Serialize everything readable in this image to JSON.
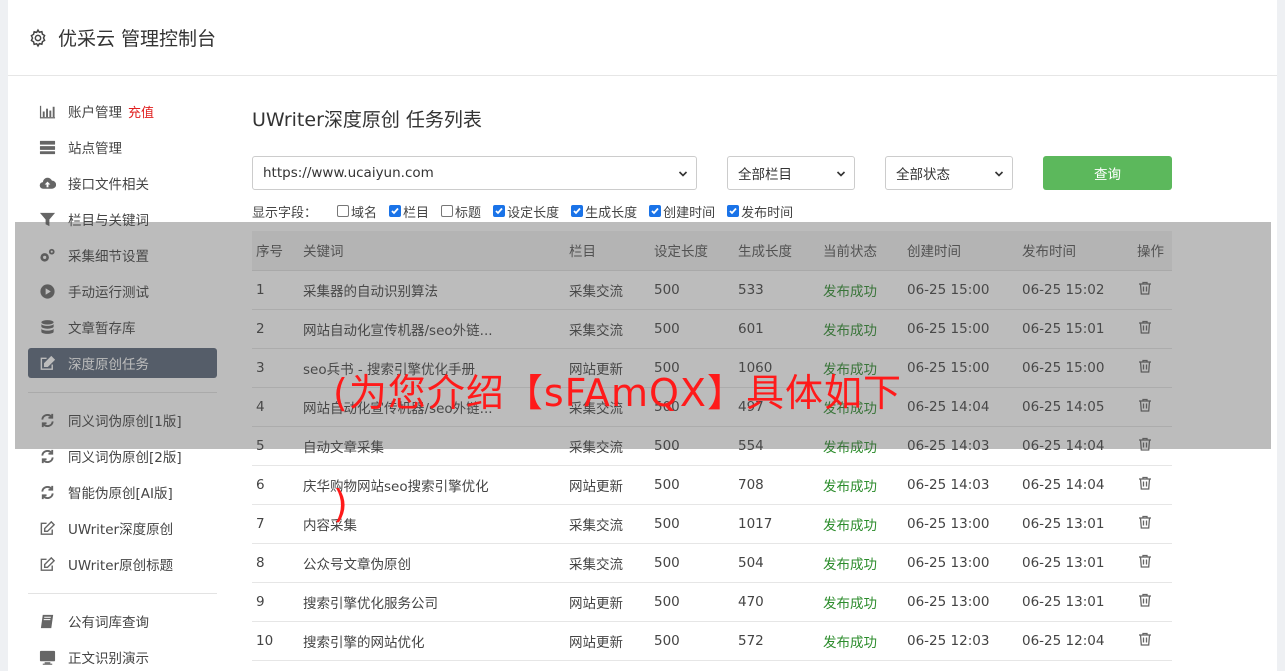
{
  "header": {
    "title": "优采云 管理控制台"
  },
  "sidebar": {
    "groups": [
      [
        {
          "label": "账户管理",
          "badge": "充值",
          "icon": "bar-chart-icon"
        },
        {
          "label": "站点管理",
          "icon": "server-icon"
        },
        {
          "label": "接口文件相关",
          "icon": "cloud-upload-icon"
        },
        {
          "label": "栏目与关键词",
          "icon": "filter-icon"
        },
        {
          "label": "采集细节设置",
          "icon": "cogs-icon"
        },
        {
          "label": "手动运行测试",
          "icon": "play-circle-icon"
        },
        {
          "label": "文章暂存库",
          "icon": "database-icon"
        },
        {
          "label": "深度原创任务",
          "icon": "edit-icon",
          "active": true
        }
      ],
      [
        {
          "label": "同义词伪原创[1版]",
          "icon": "refresh-icon"
        },
        {
          "label": "同义词伪原创[2版]",
          "icon": "refresh-icon"
        },
        {
          "label": "智能伪原创[AI版]",
          "icon": "refresh-icon"
        },
        {
          "label": "UWriter深度原创",
          "icon": "edit-icon"
        },
        {
          "label": "UWriter原创标题",
          "icon": "edit-icon"
        }
      ],
      [
        {
          "label": "公有词库查询",
          "icon": "book-icon"
        },
        {
          "label": "正文识别演示",
          "icon": "monitor-icon"
        }
      ]
    ]
  },
  "main": {
    "title": "UWriter深度原创 任务列表",
    "filters": {
      "site": "https://www.ucaiyun.com",
      "column": "全部栏目",
      "status": "全部状态",
      "query_label": "查询"
    },
    "fields_label": "显示字段：",
    "fields": [
      {
        "label": "域名",
        "checked": false
      },
      {
        "label": "栏目",
        "checked": true
      },
      {
        "label": "标题",
        "checked": false
      },
      {
        "label": "设定长度",
        "checked": true
      },
      {
        "label": "生成长度",
        "checked": true
      },
      {
        "label": "创建时间",
        "checked": true
      },
      {
        "label": "发布时间",
        "checked": true
      }
    ],
    "table": {
      "headers": [
        "序号",
        "关键词",
        "栏目",
        "设定长度",
        "生成长度",
        "当前状态",
        "创建时间",
        "发布时间",
        "操作"
      ],
      "rows": [
        [
          "1",
          "采集器的自动识别算法",
          "采集交流",
          "500",
          "533",
          "发布成功",
          "06-25 15:00",
          "06-25 15:02"
        ],
        [
          "2",
          "网站自动化宣传机器/seo外链...",
          "采集交流",
          "500",
          "601",
          "发布成功",
          "06-25 15:00",
          "06-25 15:01"
        ],
        [
          "3",
          "seo兵书 - 搜索引擎优化手册",
          "网站更新",
          "500",
          "1060",
          "发布成功",
          "06-25 15:00",
          "06-25 15:00"
        ],
        [
          "4",
          "网站自动化宣传机器/seo外链...",
          "采集交流",
          "500",
          "497",
          "发布成功",
          "06-25 14:04",
          "06-25 14:05"
        ],
        [
          "5",
          "自动文章采集",
          "采集交流",
          "500",
          "554",
          "发布成功",
          "06-25 14:03",
          "06-25 14:04"
        ],
        [
          "6",
          "庆华购物网站seo搜索引擎优化",
          "网站更新",
          "500",
          "708",
          "发布成功",
          "06-25 14:03",
          "06-25 14:04"
        ],
        [
          "7",
          "内容采集",
          "采集交流",
          "500",
          "1017",
          "发布成功",
          "06-25 13:00",
          "06-25 13:01"
        ],
        [
          "8",
          "公众号文章伪原创",
          "采集交流",
          "500",
          "504",
          "发布成功",
          "06-25 13:00",
          "06-25 13:01"
        ],
        [
          "9",
          "搜索引擎优化服务公司",
          "网站更新",
          "500",
          "470",
          "发布成功",
          "06-25 13:00",
          "06-25 13:01"
        ],
        [
          "10",
          "搜索引擎的网站优化",
          "网站更新",
          "500",
          "572",
          "发布成功",
          "06-25 12:03",
          "06-25 12:04"
        ]
      ]
    }
  },
  "overlay": {
    "text_line1": "(为您介绍【sFAmQX】具体如下",
    "text_line2": ")"
  },
  "colors": {
    "active_nav": "#5a6779",
    "query_button": "#5cb85c",
    "status_ok": "#2c8c2c",
    "badge": "#e02020",
    "watermark": "#ff1a1a"
  }
}
